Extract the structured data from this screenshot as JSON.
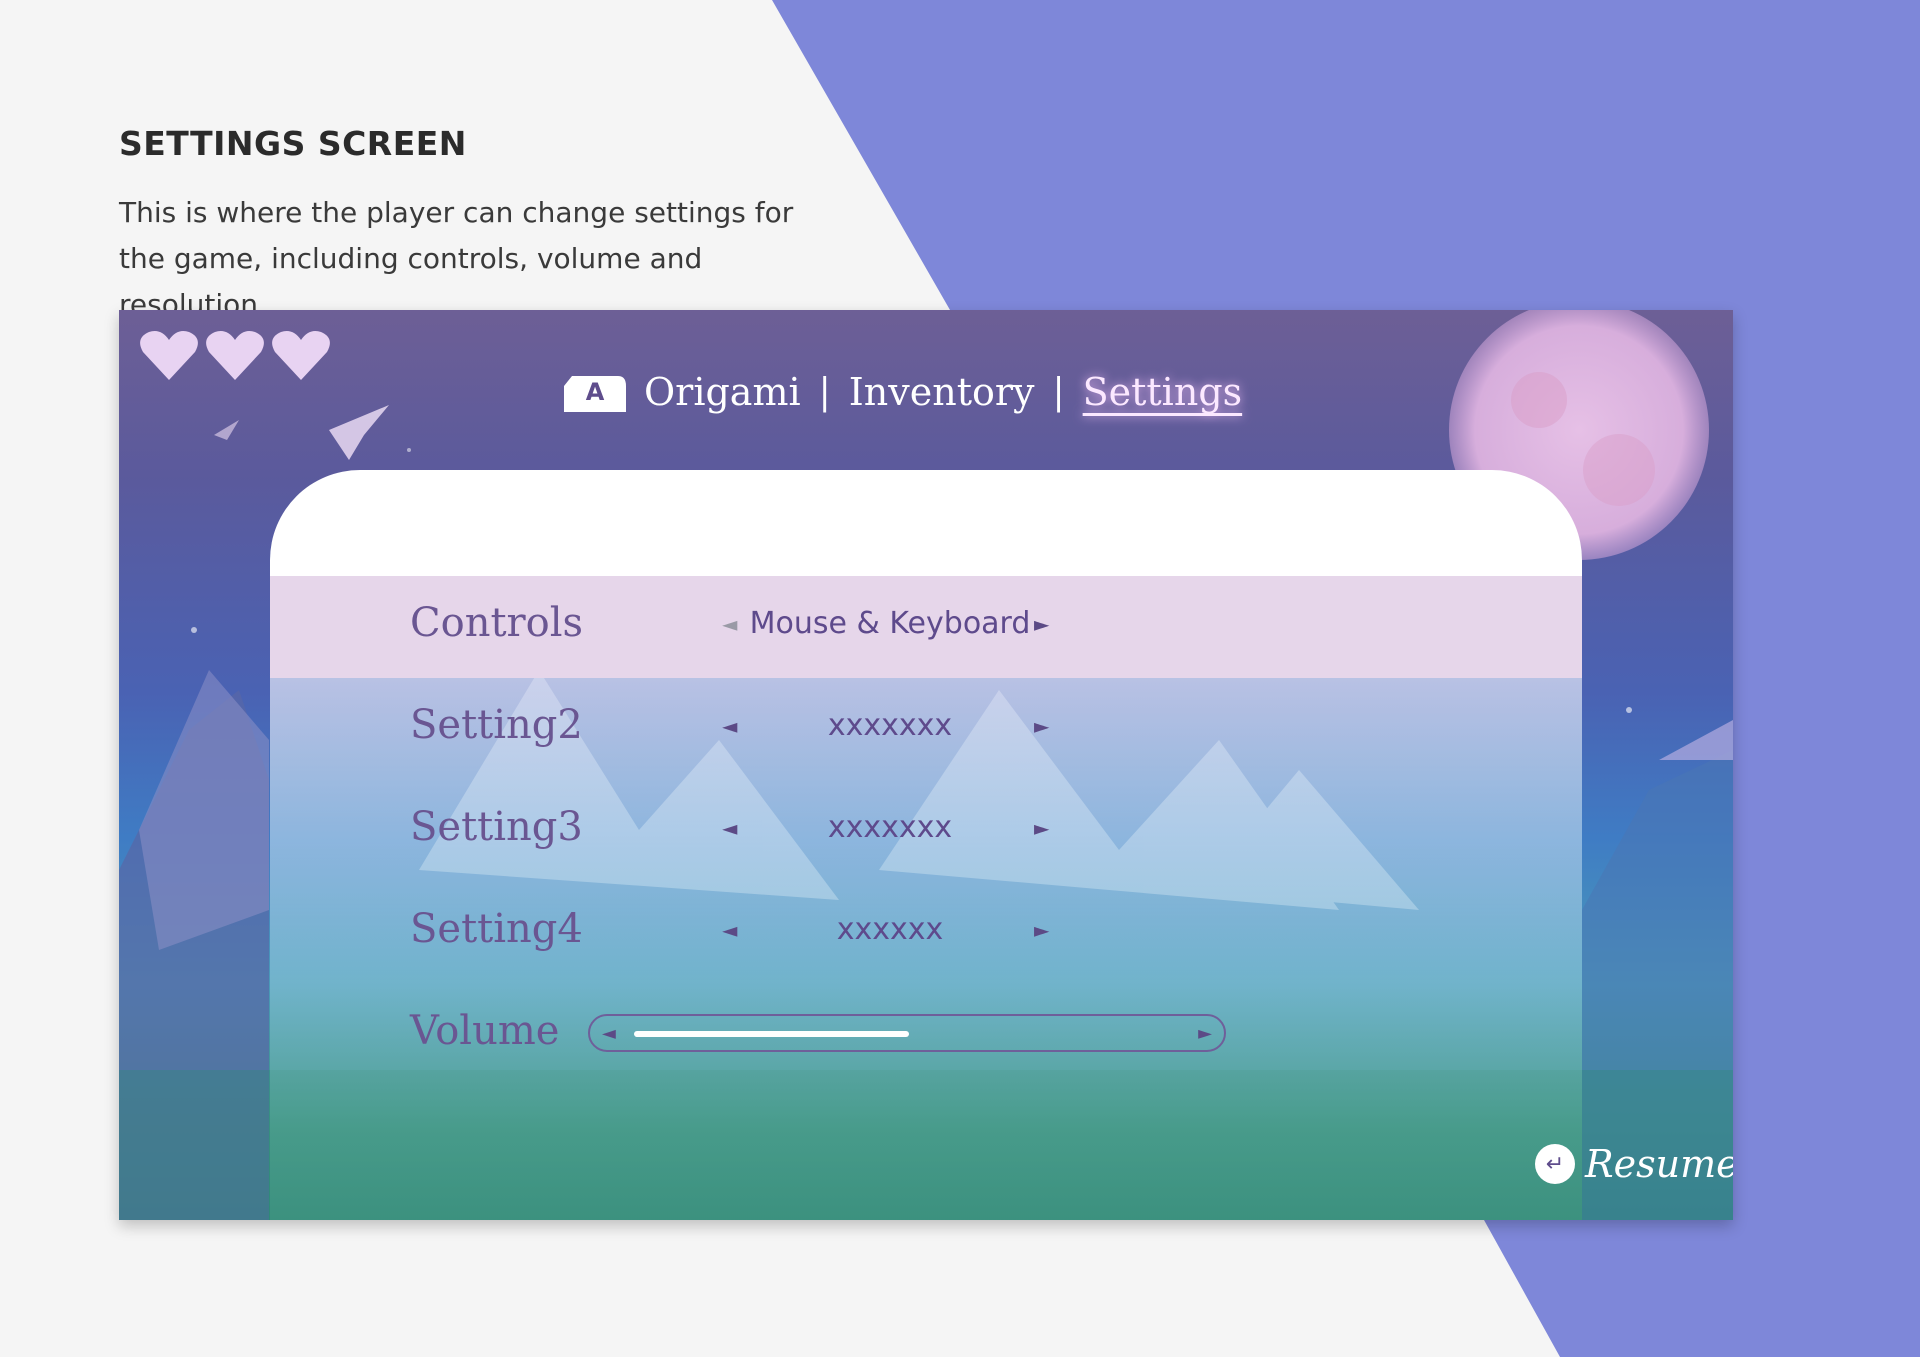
{
  "doc": {
    "title": "SETTINGS SCREEN",
    "description": "This is where the player can change settings for the game, including controls, volume and resolution."
  },
  "colors": {
    "page_bg": "#f5f5f5",
    "accent_blue": "#7e87d9",
    "panel_highlight": "#e6d6ea",
    "text_purple": "#6a5692"
  },
  "hud": {
    "hearts": [
      {
        "icon": "heart-icon"
      },
      {
        "icon": "heart-icon"
      },
      {
        "icon": "heart-icon"
      }
    ]
  },
  "nav": {
    "badge": "A",
    "items": [
      {
        "label": "Origami",
        "active": false
      },
      {
        "label": "Inventory",
        "active": false
      },
      {
        "label": "Settings",
        "active": true
      }
    ],
    "separator": "|"
  },
  "settings": {
    "rows": [
      {
        "label": "Controls",
        "value": "Mouse & Keyboard",
        "selected": true
      },
      {
        "label": "Setting2",
        "value": "xxxxxxx",
        "selected": false
      },
      {
        "label": "Setting3",
        "value": "xxxxxxx",
        "selected": false
      },
      {
        "label": "Setting4",
        "value": "xxxxxx",
        "selected": false
      }
    ],
    "volume": {
      "label": "Volume",
      "level": 0.5
    }
  },
  "resume": {
    "label": "Resume",
    "icon": "return-arrow-icon"
  }
}
